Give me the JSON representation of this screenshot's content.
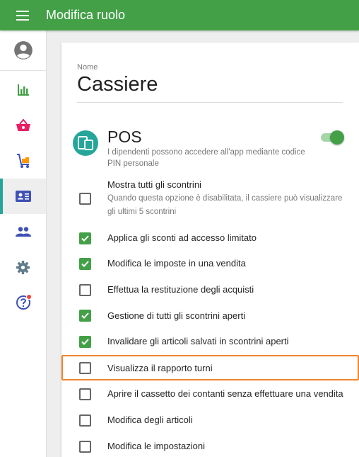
{
  "app": {
    "title": "Modifica ruolo"
  },
  "sidebar": {
    "items": [
      {
        "icon": "reports-icon",
        "name": "sidebar-item-reports"
      },
      {
        "icon": "basket-icon",
        "name": "sidebar-item-items"
      },
      {
        "icon": "inventory-icon",
        "name": "sidebar-item-inventory"
      },
      {
        "icon": "employees-card-icon",
        "name": "sidebar-item-employees",
        "active": true
      },
      {
        "icon": "customers-icon",
        "name": "sidebar-item-customers"
      },
      {
        "icon": "gear-icon",
        "name": "sidebar-item-settings"
      },
      {
        "icon": "help-icon",
        "name": "sidebar-item-help",
        "badge": true
      }
    ]
  },
  "form": {
    "name_label": "Nome",
    "name_value": "Cassiere"
  },
  "pos": {
    "title": "POS",
    "description": "I dipendenti possono accedere all'app mediante codice PIN personale",
    "enabled": true
  },
  "permissions": [
    {
      "label": "Mostra tutti gli scontrini",
      "description": "Quando questa opzione è disabilitata, il cassiere può visualizzare gli ultimi 5 scontrini",
      "checked": false
    },
    {
      "label": "Applica gli sconti ad accesso limitato",
      "checked": true
    },
    {
      "label": "Modifica le imposte in una vendita",
      "checked": true
    },
    {
      "label": "Effettua la restituzione degli acquisti",
      "checked": false
    },
    {
      "label": "Gestione di tutti gli scontrini aperti",
      "checked": true
    },
    {
      "label": "Invalidare gli articoli salvati in scontrini aperti",
      "checked": true
    },
    {
      "label": "Visualizza il rapporto turni",
      "checked": false,
      "highlighted": true
    },
    {
      "label": "Aprire il cassetto dei contanti senza effettuare una vendita",
      "checked": false
    },
    {
      "label": "Modifica degli articoli",
      "checked": false
    },
    {
      "label": "Modifica le impostazioni",
      "checked": false
    }
  ],
  "colors": {
    "primary": "#43a047",
    "accent": "#26a69a",
    "sidebar_icon": "#3f51b5",
    "basket_icon": "#e91e63",
    "highlight": "#f0852d"
  }
}
